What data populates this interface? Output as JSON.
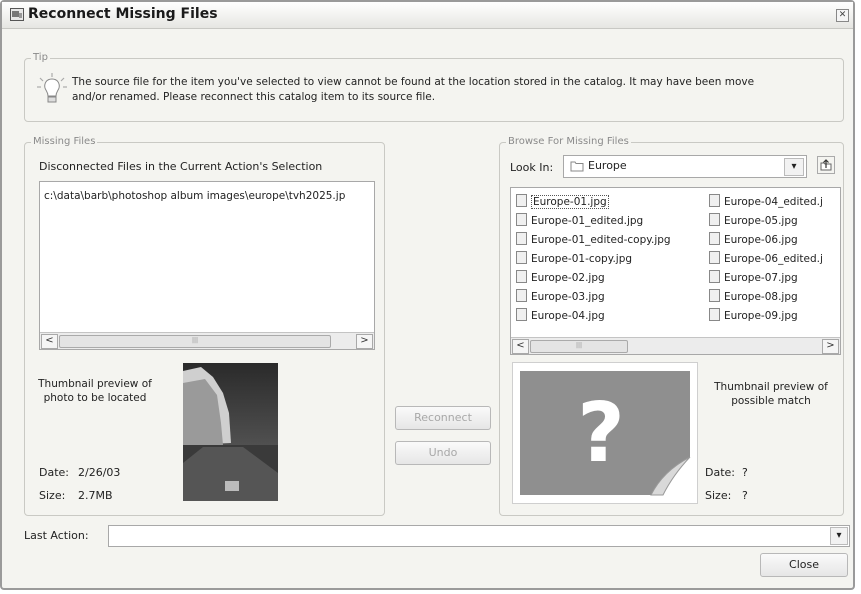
{
  "window": {
    "title": "Reconnect Missing Files"
  },
  "tip": {
    "legend": "Tip",
    "line1": "The source file for the item you've selected to view cannot be found at the location stored in the catalog. It may have been move",
    "line2": "and/or renamed. Please reconnect this catalog item to its source file."
  },
  "missing": {
    "legend": "Missing Files",
    "heading": "Disconnected Files in the Current Action's Selection",
    "path": "c:\\data\\barb\\photoshop album images\\europe\\tvh2025.jp",
    "thumb_caption_1": "Thumbnail preview of",
    "thumb_caption_2": "photo to be located",
    "date_label": "Date:",
    "date_value": "2/26/03",
    "size_label": "Size:",
    "size_value": "2.7MB"
  },
  "actions": {
    "reconnect": "Reconnect",
    "undo": "Undo"
  },
  "browse": {
    "legend": "Browse For Missing Files",
    "look_in_label": "Look In:",
    "look_in_value": "Europe",
    "files_col1": [
      "Europe-01.jpg",
      "Europe-01_edited.jpg",
      "Europe-01_edited-copy.jpg",
      "Europe-01-copy.jpg",
      "Europe-02.jpg",
      "Europe-03.jpg",
      "Europe-04.jpg"
    ],
    "files_col2": [
      "Europe-04_edited.j",
      "Europe-05.jpg",
      "Europe-06.jpg",
      "Europe-06_edited.j",
      "Europe-07.jpg",
      "Europe-08.jpg",
      "Europe-09.jpg"
    ],
    "match_caption_1": "Thumbnail preview of",
    "match_caption_2": "possible match",
    "date_label": "Date:",
    "date_value": "?",
    "size_label": "Size:",
    "size_value": "?"
  },
  "footer": {
    "last_action_label": "Last Action:",
    "last_action_value": "",
    "close": "Close"
  }
}
